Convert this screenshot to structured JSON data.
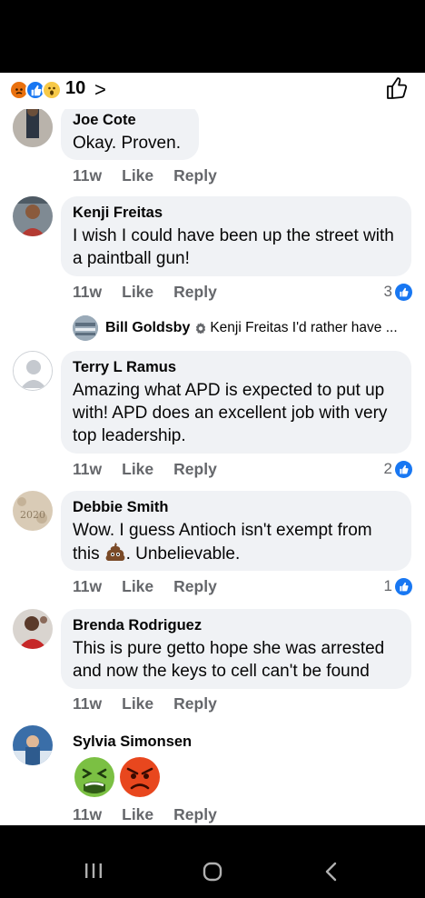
{
  "reactions": {
    "count": "10",
    "chevron": ">",
    "icons": [
      "angry-reaction",
      "like-reaction",
      "wow-reaction"
    ]
  },
  "comments": [
    {
      "author": "Joe Cote",
      "text": "Okay. Proven.",
      "time": "11w",
      "like": "Like",
      "reply": "Reply"
    },
    {
      "author": "Kenji Freitas",
      "text": "I wish I could have been up the street with a paintball gun!",
      "time": "11w",
      "like": "Like",
      "reply": "Reply",
      "reactions": "3"
    },
    {
      "author": "Terry L Ramus",
      "text": "Amazing what APD is expected to put up with!  APD does an excellent job with very top leadership.",
      "time": "11w",
      "like": "Like",
      "reply": "Reply",
      "reactions": "2"
    },
    {
      "author": "Debbie Smith",
      "text_before": "Wow. I guess Antioch isn't exempt from this",
      "text_after": ". Unbelievable.",
      "time": "11w",
      "like": "Like",
      "reply": "Reply",
      "reactions": "1"
    },
    {
      "author": "Brenda Rodriguez",
      "text": "This is pure getto hope she was arrested and now the keys to cell can't be found",
      "time": "11w",
      "like": "Like",
      "reply": "Reply"
    },
    {
      "author": "Sylvia Simonsen",
      "time": "11w",
      "like": "Like",
      "reply": "Reply"
    }
  ],
  "reply_preview": {
    "author": "Bill Goldsby",
    "text": "Kenji Freitas I'd rather have ..."
  },
  "colors": {
    "bubble": "#f0f2f5",
    "like_blue": "#1877f2",
    "meta_gray": "#65676b"
  }
}
